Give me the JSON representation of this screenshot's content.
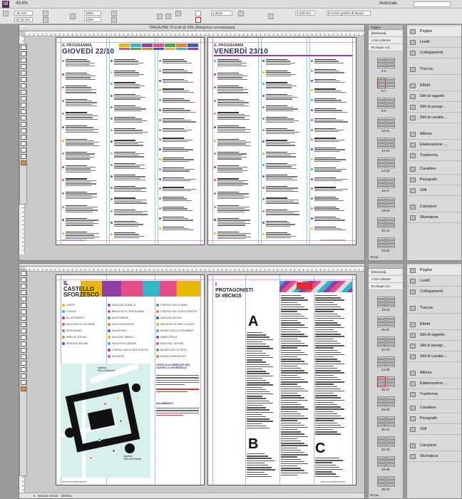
{
  "app": {
    "logo": "Id",
    "zoom": "43,6%",
    "workspace": "Avanzate",
    "object_style": "[Cornice grafica di base]+",
    "x_value": "-32 mm",
    "y_value": "22,75 mm",
    "stroke": "1,05 pt",
    "width_value": "4,233 mm",
    "percent1": "100%",
    "percent2": "100%"
  },
  "doc_top": {
    "title": "*MAGAZINE 29.indd @ 43% [Anteprima sovrastampa]",
    "ruler_marks": [
      "0",
      "50",
      "100",
      "150",
      "200",
      "250",
      "300",
      "350",
      "400"
    ],
    "left_page": {
      "header_small": "IL PROGRAMMA",
      "header_big": "GIOVEDÌ 22/10"
    },
    "right_page": {
      "header_small": "IL PROGRAMMA",
      "header_big": "VENERDÌ 23/10"
    },
    "footer_left": "www.bookcitymilano.it",
    "footer_right": "www.bookcitymilano.it"
  },
  "doc_bottom": {
    "status_text": "Nessun errore",
    "status_page": "5",
    "verifica": "Verifica",
    "left_page": {
      "title_lines": [
        "IL",
        "CASTELLO",
        "SFORZESCO"
      ],
      "legend_col1": [
        "CORTE",
        "LOGGIA",
        "ALLESTIMENTI",
        "SALA DELLE COLONNE",
        "SPEDIZIONE",
        "SERVIZI SOCIALI",
        "ENTRATA SOLARI"
      ],
      "legend_col2": [
        "SALA DELLA BALLA",
        "BIBLIOTECA TRIVULZIANA",
        "AUDITORIUM",
        "SALA VISCONTEA",
        "SALA PONTI",
        "SALA DEL MERLO",
        "SALA DEGLI ARAZZI",
        "CORTILE DELLA ROCCHETTA",
        "ARCHIVIO"
      ],
      "legend_col3": [
        "CORTILE DELLE ARMI",
        "CORTILE DELLA ROCCHETTA",
        "SALA DEI DUCALI",
        "ARCHIVIO STORICO CIVICO",
        "MUSEO DEGLI STRUMENTI",
        "PINACOTECA",
        "SALA DEL TESORO",
        "MUSEO DELLA PIETÀ",
        "SPAZIO ESPOSITIVO"
      ],
      "map_label1": "Ingresso\nPiazza Castello",
      "map_label2": "Ingresso\nParco Sempione",
      "map_label3": "Ingresso\nTorre Del Filarete",
      "info_heading": "VISITE ALLE MERLATE DEL CASTELLO SFORZESCO",
      "info_heading2": "INCAMMINATI",
      "footer": "www.bookcitymilano.it"
    },
    "right_page": {
      "title_lines": [
        "I",
        "PROTAGONISTI",
        "DI #BCM15"
      ],
      "letters": [
        "A",
        "B",
        "C"
      ],
      "footer": "www.bookcitymilano.it"
    }
  },
  "pages_panel_top": {
    "tab": "Pagine",
    "none": "[Nessuna]",
    "master_a": "A-tre colonne",
    "master_b": "B-cinque col...",
    "labels": [
      "4-5",
      "6-7",
      "8-9",
      "10-11",
      "12-13",
      "14-15",
      "16-17",
      "18-19",
      "20-21",
      "22-23"
    ],
    "footer": "40 pa..."
  },
  "pages_panel_bottom": {
    "none": "[Nessuna]",
    "master_a": "A-tre colonne",
    "master_b": "B-cinque col...",
    "labels": [
      "18-19",
      "20-21",
      "22-23",
      "24-25",
      "26-27",
      "28-29",
      "30-31",
      "32-33",
      "34-35",
      "36-37"
    ],
    "footer": "40 pa..."
  },
  "side_panel_top": [
    "Pagine",
    "Livelli",
    "Collegamenti",
    "Traccia",
    "Effetti",
    "Stili di oggetto",
    "Stili di paragr...",
    "Stili di caratte...",
    "Allinea",
    "Elaborazione ...",
    "Trasforma",
    "Carattere",
    "Paragrafo",
    "Glifi",
    "Campioni",
    "Sfumatura"
  ],
  "side_panel_bottom": [
    "Pagine",
    "Livelli",
    "Collegamenti",
    "Traccia",
    "Effetti",
    "Stili di oggetto",
    "Stili di paragr...",
    "Stili di caratte...",
    "Allinea",
    "Elaborazione ...",
    "Trasforma",
    "Carattere",
    "Paragrafo",
    "Glifi",
    "Campioni",
    "Sfumatura"
  ],
  "colors": {
    "stripe": [
      "#e6b800",
      "#2eb8c8",
      "#8e3fa8",
      "#e84d8a",
      "#4aa84a",
      "#ee7d2e",
      "#3b5bb0"
    ],
    "accent_navy": "#2d2d6e",
    "map_bg": "#d6efea"
  }
}
